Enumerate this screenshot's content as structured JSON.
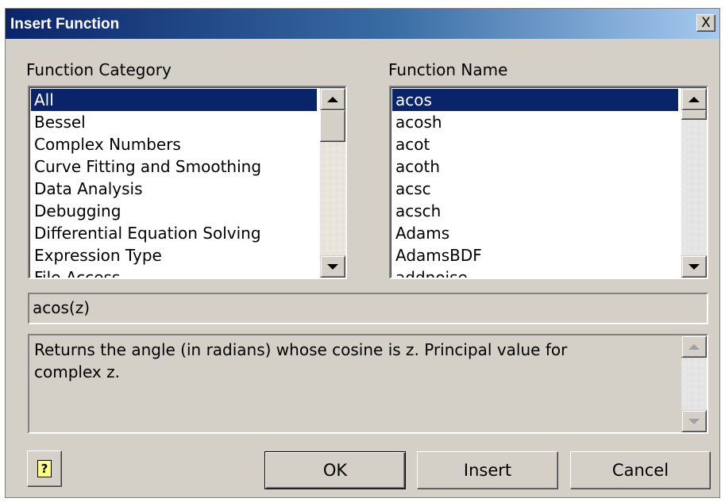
{
  "window": {
    "title": "Insert Function",
    "close_glyph": "X"
  },
  "category": {
    "label": "Function Category",
    "items": [
      "All",
      "Bessel",
      "Complex Numbers",
      "Curve Fitting and Smoothing",
      "Data Analysis",
      "Debugging",
      "Differential Equation Solving",
      "Expression Type",
      "File Access"
    ],
    "selected": "All"
  },
  "function": {
    "label": "Function Name",
    "items": [
      "acos",
      "acosh",
      "acot",
      "acoth",
      "acsc",
      "acsch",
      "Adams",
      "AdamsBDF",
      "addnoise"
    ],
    "selected": "acos"
  },
  "signature": "acos(z)",
  "description": {
    "line1": "Returns the angle (in radians) whose cosine is z. Principal value for",
    "line2": "complex z."
  },
  "buttons": {
    "help_glyph": "?",
    "ok": "OK",
    "insert": "Insert",
    "cancel": "Cancel"
  },
  "colors": {
    "title_start": "#0a246a",
    "title_end": "#a6caf0",
    "selection": "#0a246a",
    "dialog_face": "#d4d0c8"
  },
  "icons": {
    "help": "help-question-icon",
    "close": "close-icon",
    "scroll_up": "arrow-up-icon",
    "scroll_down": "arrow-down-icon"
  }
}
